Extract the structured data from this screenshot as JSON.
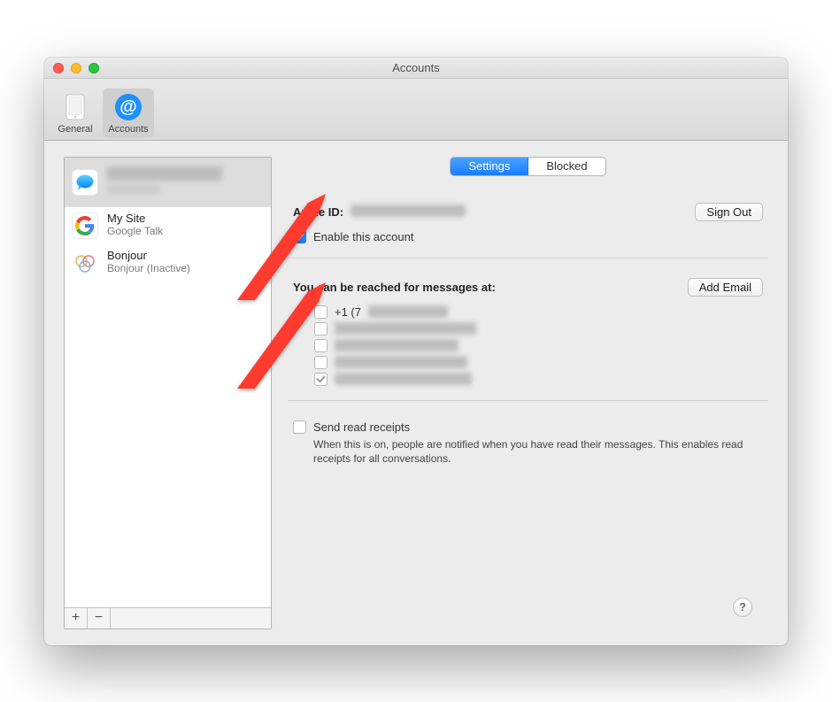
{
  "window": {
    "title": "Accounts"
  },
  "toolbar": {
    "items": [
      {
        "label": "General"
      },
      {
        "label": "Accounts"
      }
    ]
  },
  "sidebar": {
    "accounts": [
      {
        "name": "",
        "sub": ""
      },
      {
        "name": "My Site",
        "sub": "Google Talk"
      },
      {
        "name": "Bonjour",
        "sub": "Bonjour (Inactive)"
      }
    ],
    "add": "+",
    "remove": "−"
  },
  "segmented": {
    "settings": "Settings",
    "blocked": "Blocked"
  },
  "account": {
    "apple_id_label": "Apple ID:",
    "sign_out": "Sign Out",
    "enable_label": "Enable this account",
    "enable_checked": true
  },
  "reached": {
    "title": "You can be reached for messages at:",
    "add_email": "Add Email",
    "items": [
      {
        "checked": false,
        "text": "+1 (7"
      },
      {
        "checked": false,
        "text": ""
      },
      {
        "checked": false,
        "text": ""
      },
      {
        "checked": false,
        "text": ""
      },
      {
        "checked": true,
        "text": ""
      }
    ]
  },
  "receipts": {
    "label": "Send read receipts",
    "desc": "When this is on, people are notified when you have read their messages. This enables read receipts for all conversations."
  },
  "help": "?"
}
